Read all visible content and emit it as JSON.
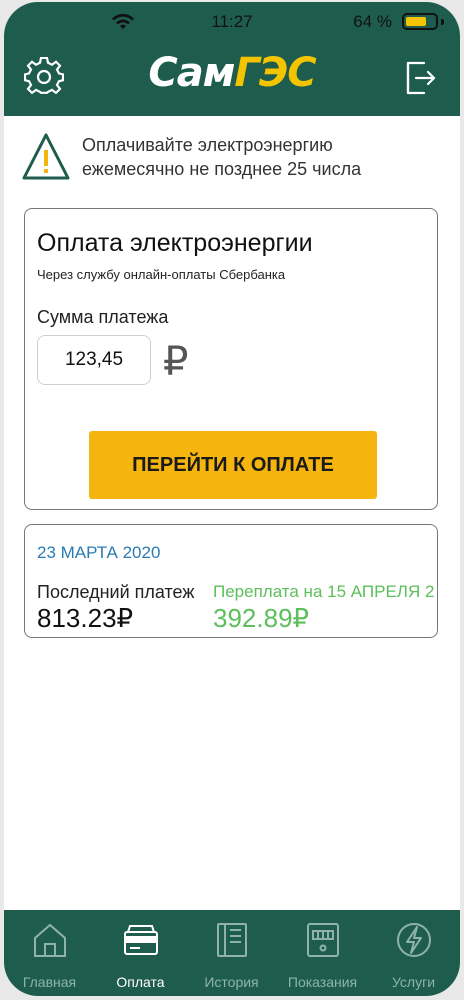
{
  "status_bar": {
    "time": "11:27",
    "battery_percent": "64 %"
  },
  "header": {
    "logo_part1": "Сам",
    "logo_part2": "ГЭС",
    "settings_icon": "gear-icon",
    "logout_icon": "logout-icon"
  },
  "notice": {
    "line1": "Оплачивайте электроэнергию",
    "line2": "ежемесячно не позднее 25 числа"
  },
  "payment_card": {
    "title": "Оплата электроэнергии",
    "subtitle": "Через службу онлайн-оплаты Сбербанка",
    "amount_label": "Сумма платежа",
    "amount_value": "123,45",
    "currency_symbol": "₽",
    "pay_button_label": "ПЕРЕЙТИ К ОПЛАТЕ"
  },
  "info_card": {
    "date": "23 МАРТА 2020",
    "last_payment_label": "Последний платеж",
    "last_payment_value": "813.23₽",
    "overpayment_label": "Переплата на 15 АПРЕЛЯ 2",
    "overpayment_value": "392.89₽"
  },
  "tabs": [
    {
      "label": "Главная",
      "icon": "home-icon"
    },
    {
      "label": "Оплата",
      "icon": "wallet-icon"
    },
    {
      "label": "История",
      "icon": "book-icon"
    },
    {
      "label": "Показания",
      "icon": "meter-icon"
    },
    {
      "label": "Услуги",
      "icon": "lightning-icon"
    }
  ],
  "active_tab": "Оплата",
  "colors": {
    "brand_green": "#1e5d4e",
    "accent_yellow": "#f5b50e",
    "date_blue": "#2b7bb3",
    "overpay_green": "#5cbf5a"
  }
}
